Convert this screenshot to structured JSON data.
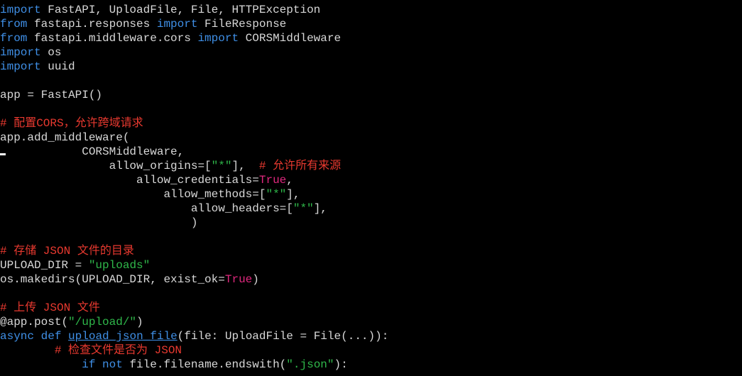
{
  "editor": {
    "lines": [
      [
        {
          "t": "import",
          "c": "kw"
        },
        {
          "t": " FastAPI, UploadFile, File, HTTPException",
          "c": "default"
        }
      ],
      [
        {
          "t": "from",
          "c": "kw"
        },
        {
          "t": " fastapi.responses ",
          "c": "default"
        },
        {
          "t": "import",
          "c": "kw"
        },
        {
          "t": " FileResponse",
          "c": "default"
        }
      ],
      [
        {
          "t": "from",
          "c": "kw"
        },
        {
          "t": " fastapi.middleware.cors ",
          "c": "default"
        },
        {
          "t": "import",
          "c": "kw"
        },
        {
          "t": " CORSMiddleware",
          "c": "default"
        }
      ],
      [
        {
          "t": "import",
          "c": "kw"
        },
        {
          "t": " os",
          "c": "default"
        }
      ],
      [
        {
          "t": "import",
          "c": "kw"
        },
        {
          "t": " uuid",
          "c": "default"
        }
      ],
      [],
      [
        {
          "t": "app = FastAPI()",
          "c": "default"
        }
      ],
      [],
      [
        {
          "t": "# 配置CORS，允许跨域请求",
          "c": "comment"
        }
      ],
      [
        {
          "t": "app.add_middleware(",
          "c": "default"
        }
      ],
      [
        {
          "t": "            CORSMiddleware,",
          "c": "default"
        }
      ],
      [
        {
          "t": "                allow_origins=[",
          "c": "default"
        },
        {
          "t": "\"*\"",
          "c": "string"
        },
        {
          "t": "],  ",
          "c": "default"
        },
        {
          "t": "# 允许所有来源",
          "c": "comment"
        }
      ],
      [
        {
          "t": "                    allow_credentials=",
          "c": "default"
        },
        {
          "t": "True",
          "c": "const"
        },
        {
          "t": ",",
          "c": "default"
        }
      ],
      [
        {
          "t": "                        allow_methods=[",
          "c": "default"
        },
        {
          "t": "\"*\"",
          "c": "string"
        },
        {
          "t": "],",
          "c": "default"
        }
      ],
      [
        {
          "t": "                            allow_headers=[",
          "c": "default"
        },
        {
          "t": "\"*\"",
          "c": "string"
        },
        {
          "t": "],",
          "c": "default"
        }
      ],
      [
        {
          "t": "                            )",
          "c": "default"
        }
      ],
      [],
      [
        {
          "t": "# 存储 JSON 文件的目录",
          "c": "comment"
        }
      ],
      [
        {
          "t": "UPLOAD_DIR = ",
          "c": "default"
        },
        {
          "t": "\"uploads\"",
          "c": "string"
        }
      ],
      [
        {
          "t": "os.makedirs(UPLOAD_DIR, exist_ok=",
          "c": "default"
        },
        {
          "t": "True",
          "c": "const"
        },
        {
          "t": ")",
          "c": "default"
        }
      ],
      [],
      [
        {
          "t": "# 上传 JSON 文件",
          "c": "comment"
        }
      ],
      [
        {
          "t": "@app.post(",
          "c": "default"
        },
        {
          "t": "\"/upload/\"",
          "c": "string"
        },
        {
          "t": ")",
          "c": "default"
        }
      ],
      [
        {
          "t": "async",
          "c": "kw"
        },
        {
          "t": " ",
          "c": "default"
        },
        {
          "t": "def",
          "c": "kw"
        },
        {
          "t": " ",
          "c": "default"
        },
        {
          "t": "upload_json_file",
          "c": "fn"
        },
        {
          "t": "(file: UploadFile = File(...)):",
          "c": "default"
        }
      ],
      [
        {
          "t": "        ",
          "c": "default"
        },
        {
          "t": "# 检查文件是否为 JSON",
          "c": "comment"
        }
      ],
      [
        {
          "t": "            ",
          "c": "default"
        },
        {
          "t": "if",
          "c": "kw"
        },
        {
          "t": " ",
          "c": "default"
        },
        {
          "t": "not",
          "c": "kw"
        },
        {
          "t": " file.filename.endswith(",
          "c": "default"
        },
        {
          "t": "\".json\"",
          "c": "string"
        },
        {
          "t": "):",
          "c": "default"
        }
      ]
    ]
  }
}
